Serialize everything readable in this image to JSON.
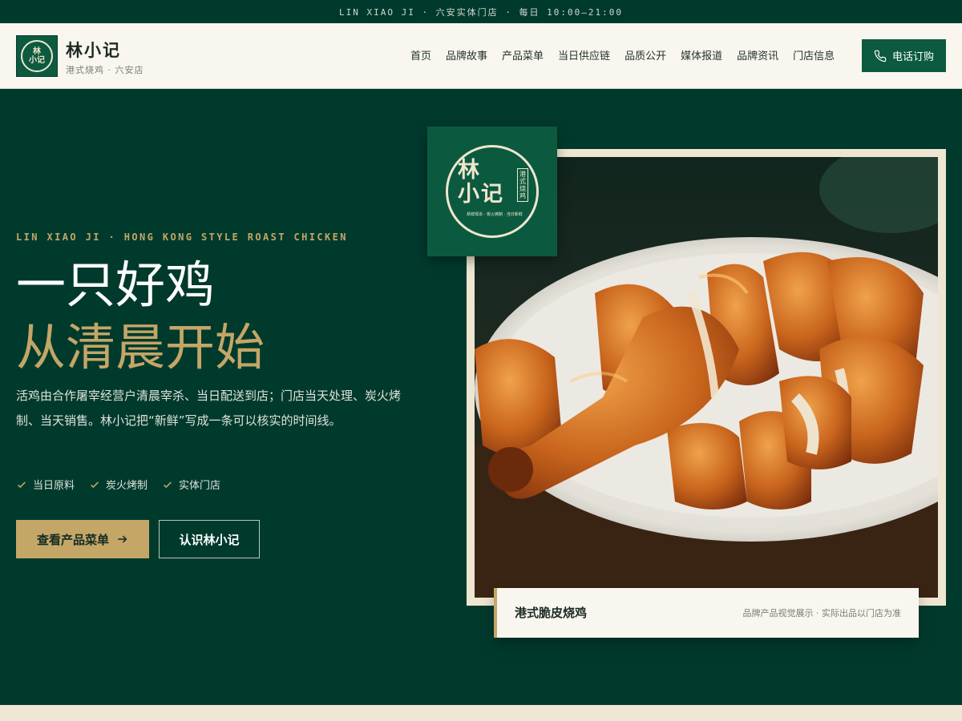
{
  "topbar": {
    "text": "LIN XIAO JI · 六安实体门店 · 每日 10:00—21:00"
  },
  "header": {
    "brand_name": "林小记",
    "brand_sub": "港式烧鸡 · 六安店",
    "logo_text": "林小记",
    "nav": [
      "首页",
      "品牌故事",
      "产品菜单",
      "当日供应链",
      "品质公开",
      "媒体报道",
      "品牌资讯",
      "门店信息"
    ],
    "call_label": "电话订购"
  },
  "hero": {
    "eyebrow": "LIN XIAO JI · HONG KONG STYLE ROAST CHICKEN",
    "headline_1": "一只好鸡",
    "headline_2": "从清晨开始",
    "description": "活鸡由合作屠宰经营户清晨宰杀、当日配送到店；门店当天处理、炭火烤制、当天销售。林小记把“新鲜”写成一条可以核实的时间线。",
    "checks": [
      "当日原料",
      "炭火烤制",
      "实体门店"
    ],
    "primary_button": "查看产品菜单",
    "secondary_button": "认识林小记"
  },
  "badge": {
    "name": "林小记",
    "side": "港式烧鸡",
    "tagline": "新鲜现杀 · 炭火烤制 · 当日新鲜"
  },
  "caption": {
    "title": "港式脆皮烧鸡",
    "note": "品牌产品视觉展示 · 实际出品以门店为准"
  },
  "colors": {
    "brand_green": "#003a2d",
    "accent_gold": "#c4a667",
    "cream": "#f8f6ef"
  }
}
